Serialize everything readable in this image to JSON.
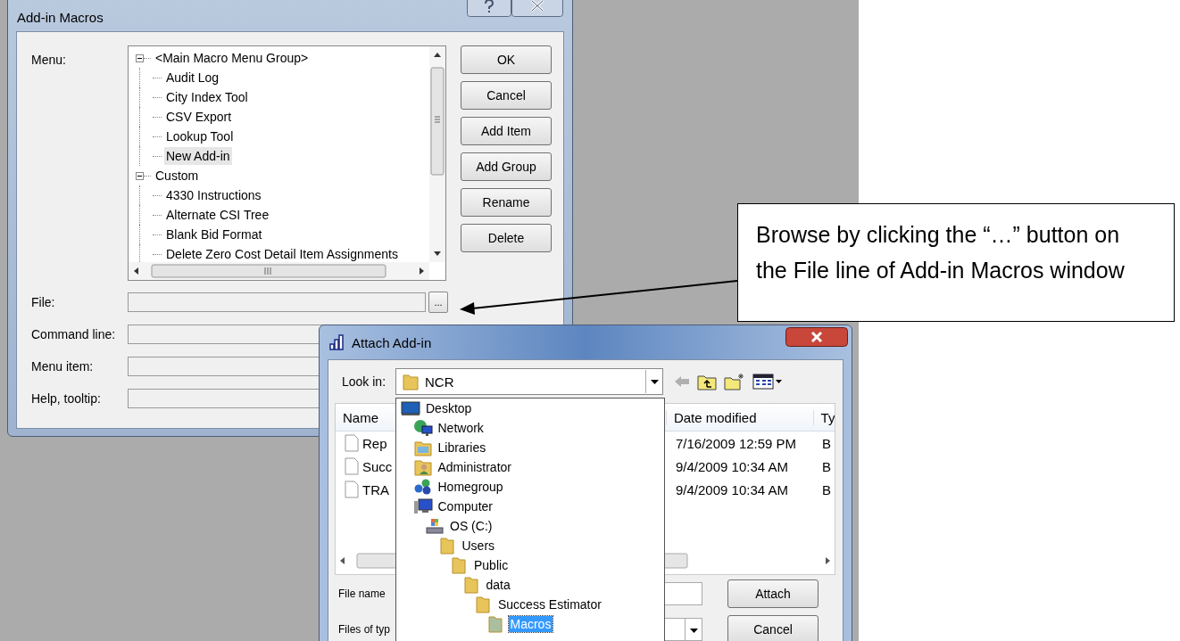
{
  "add_in_macros": {
    "title": "Add-in Macros",
    "menu_label": "Menu:",
    "menu_tree": [
      {
        "label": "<Main Macro Menu Group>",
        "expanded": true,
        "selected": false,
        "children": [
          {
            "label": "Audit Log",
            "selected": false
          },
          {
            "label": "City Index Tool",
            "selected": false
          },
          {
            "label": "CSV Export",
            "selected": false
          },
          {
            "label": "Lookup Tool",
            "selected": false
          },
          {
            "label": "New Add-in",
            "selected": true
          }
        ]
      },
      {
        "label": "Custom",
        "expanded": true,
        "selected": false,
        "children": [
          {
            "label": "4330 Instructions",
            "selected": false
          },
          {
            "label": "Alternate CSI Tree",
            "selected": false
          },
          {
            "label": "Blank Bid Format",
            "selected": false
          },
          {
            "label": "Delete Zero Cost Detail Item Assignments",
            "selected": false
          }
        ]
      }
    ],
    "buttons": [
      "OK",
      "Cancel",
      "Add Item",
      "Add Group",
      "Rename",
      "Delete"
    ],
    "fields": [
      {
        "label": "File:",
        "browse": "..."
      },
      {
        "label": "Command line:"
      },
      {
        "label": "Menu item:"
      },
      {
        "label": "Help, tooltip:"
      }
    ]
  },
  "callout": {
    "text": "Browse by clicking the “…” button on the File line of Add-in Macros window"
  },
  "attach_add_in": {
    "title": "Attach Add-in",
    "look_in_label": "Look in:",
    "look_in_value": "NCR",
    "columns": [
      "Name",
      "Date modified",
      "Ty"
    ],
    "files": [
      {
        "name": "Rep",
        "date": "7/16/2009 12:59 PM",
        "type": "B"
      },
      {
        "name": "Succ",
        "date": "9/4/2009 10:34 AM",
        "type": "B"
      },
      {
        "name": "TRA",
        "date": "9/4/2009 10:34 AM",
        "type": "B"
      }
    ],
    "file_name_label": "File name",
    "files_of_type_label": "Files of typ",
    "buttons": [
      "Attach",
      "Cancel"
    ],
    "look_in_dropdown": [
      {
        "label": "Desktop",
        "kind": "desktop",
        "selected": false,
        "children": [
          {
            "label": "Network",
            "kind": "network",
            "selected": false
          },
          {
            "label": "Libraries",
            "kind": "libraries",
            "selected": false
          },
          {
            "label": "Administrator",
            "kind": "user",
            "selected": false
          },
          {
            "label": "Homegroup",
            "kind": "homegroup",
            "selected": false
          },
          {
            "label": "Computer",
            "kind": "computer",
            "selected": false,
            "children": [
              {
                "label": "OS (C:)",
                "kind": "drive",
                "selected": false,
                "children": [
                  {
                    "label": "Users",
                    "kind": "folder",
                    "selected": false,
                    "children": [
                      {
                        "label": "Public",
                        "kind": "folder",
                        "selected": false,
                        "children": [
                          {
                            "label": "data",
                            "kind": "folder",
                            "selected": false,
                            "children": [
                              {
                                "label": "Success Estimator",
                                "kind": "folder",
                                "selected": false,
                                "children": [
                                  {
                                    "label": "Macros",
                                    "kind": "folder",
                                    "selected": true
                                  }
                                ]
                              }
                            ]
                          }
                        ]
                      }
                    ]
                  }
                ]
              }
            ]
          }
        ]
      }
    ]
  }
}
